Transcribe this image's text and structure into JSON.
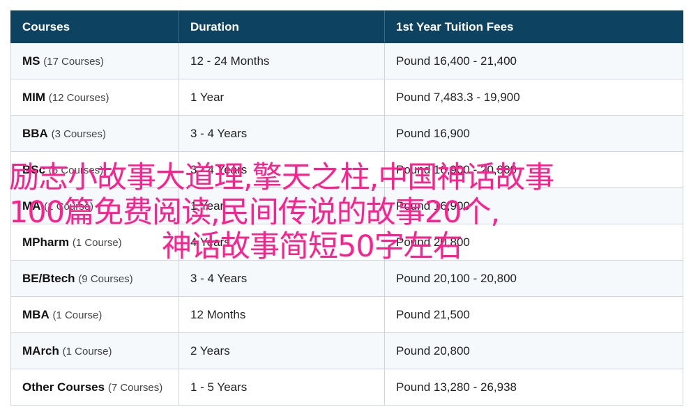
{
  "table": {
    "headers": [
      "Courses",
      "Duration",
      "1st Year Tuition Fees"
    ],
    "rows": [
      {
        "course": "MS",
        "count": "(17 Courses)",
        "duration": "12 - 24 Months",
        "fees": "Pound 16,400 - 21,400"
      },
      {
        "course": "MIM",
        "count": "(12 Courses)",
        "duration": "1 Year",
        "fees": "Pound 7,483.3 - 19,900"
      },
      {
        "course": "BBA",
        "count": "(3 Courses)",
        "duration": "3 - 4 Years",
        "fees": "Pound 16,900"
      },
      {
        "course": "BSc",
        "count": "(5 Courses)",
        "duration": "3 - 4 Years",
        "fees": "Pound 16,900 - 20,800"
      },
      {
        "course": "MA",
        "count": "(1 Course)",
        "duration": "1 Year",
        "fees": "Pound 16,900"
      },
      {
        "course": "MPharm",
        "count": "(1 Course)",
        "duration": "4 Years",
        "fees": "Pound 20,800"
      },
      {
        "course": "BE/Btech",
        "count": "(9 Courses)",
        "duration": "3 - 4 Years",
        "fees": "Pound 20,100 - 20,800"
      },
      {
        "course": "MBA",
        "count": "(1 Course)",
        "duration": "12 Months",
        "fees": "Pound 21,500"
      },
      {
        "course": "MArch",
        "count": "(1 Course)",
        "duration": "2 Years",
        "fees": "Pound 20,800"
      },
      {
        "course": "Other Courses",
        "count": "(7 Courses)",
        "duration": "1 - 5 Years",
        "fees": "Pound 13,280 - 26,938"
      }
    ]
  },
  "overlay": {
    "lines": [
      "励志小故事大道理,擎天之柱,中国神话故事",
      "100篇免费阅读,民间传说的故事20个,",
      "神话故事简短50字左右"
    ],
    "color": "#ff1f8f"
  },
  "colors": {
    "header_bg": "#0d4360",
    "header_text": "#ffffff",
    "row_alt_bg": "#f6f9fc",
    "border": "#cdd6dd"
  }
}
